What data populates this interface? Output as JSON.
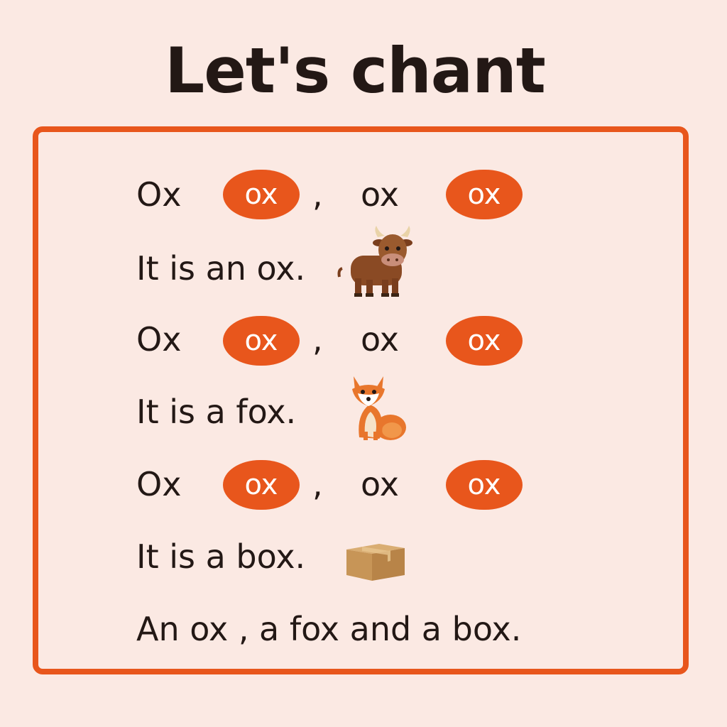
{
  "title": "Let's chant",
  "chant": {
    "rows": [
      {
        "word1": "Ox",
        "pill1": "ox",
        "comma": ",",
        "word2": "ox",
        "pill2": "ox"
      },
      {
        "word1": "Ox",
        "pill1": "ox",
        "comma": ",",
        "word2": "ox",
        "pill2": "ox"
      },
      {
        "word1": "Ox",
        "pill1": "ox",
        "comma": ",",
        "word2": "ox",
        "pill2": "ox"
      }
    ],
    "sentences": [
      "It is an ox.",
      "It is a fox.",
      "It is a box."
    ],
    "final": "An ox , a fox and a box."
  },
  "icons": [
    "ox-icon",
    "fox-icon",
    "box-icon"
  ],
  "colors": {
    "accent": "#e8561c",
    "background": "#fbe9e3",
    "text": "#231815"
  }
}
